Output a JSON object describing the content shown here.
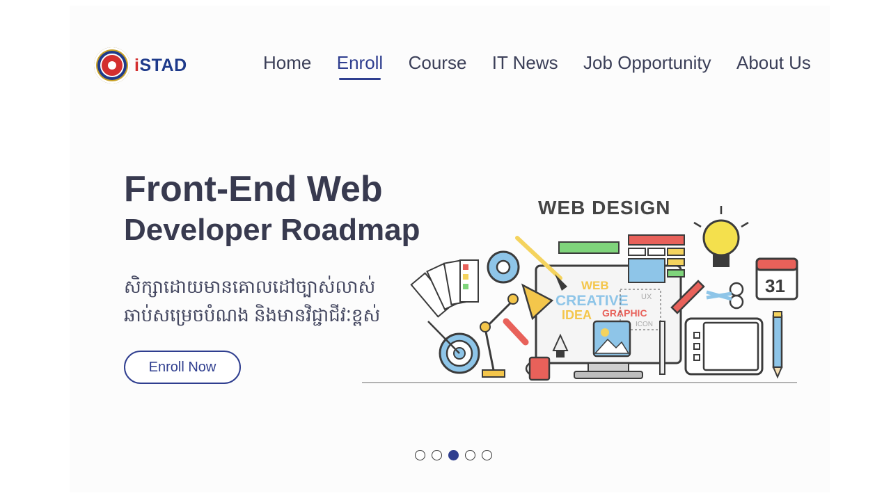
{
  "brand": {
    "name": "iSTAD"
  },
  "nav": {
    "items": [
      {
        "label": "Home"
      },
      {
        "label": "Enroll"
      },
      {
        "label": "Course"
      },
      {
        "label": "IT News"
      },
      {
        "label": "Job Opportunity"
      },
      {
        "label": "About Us"
      }
    ],
    "active": "Enroll"
  },
  "hero": {
    "title": "Front-End Web",
    "subtitle": "Developer Roadmap",
    "khmer_line_1": "សិក្សាដោយមានគោលដៅច្បាស់លាស់",
    "khmer_line_2": "ឆាប់សម្រេចបំណង និងមានវិជ្ជាជីវៈខ្ពស់",
    "cta_label": "Enroll Now"
  },
  "illustration": {
    "heading": "WEB DESIGN",
    "words": [
      "WEB",
      "CREATIVE",
      "IDEA",
      "GRAPHIC",
      "UX",
      "ICON"
    ],
    "calendar_day": "31"
  },
  "carousel": {
    "slide_count": 5,
    "active_index": 2
  },
  "colors": {
    "primary": "#2f3e8f",
    "text_dark": "#383a4f",
    "logo_red": "#d32f2f"
  }
}
